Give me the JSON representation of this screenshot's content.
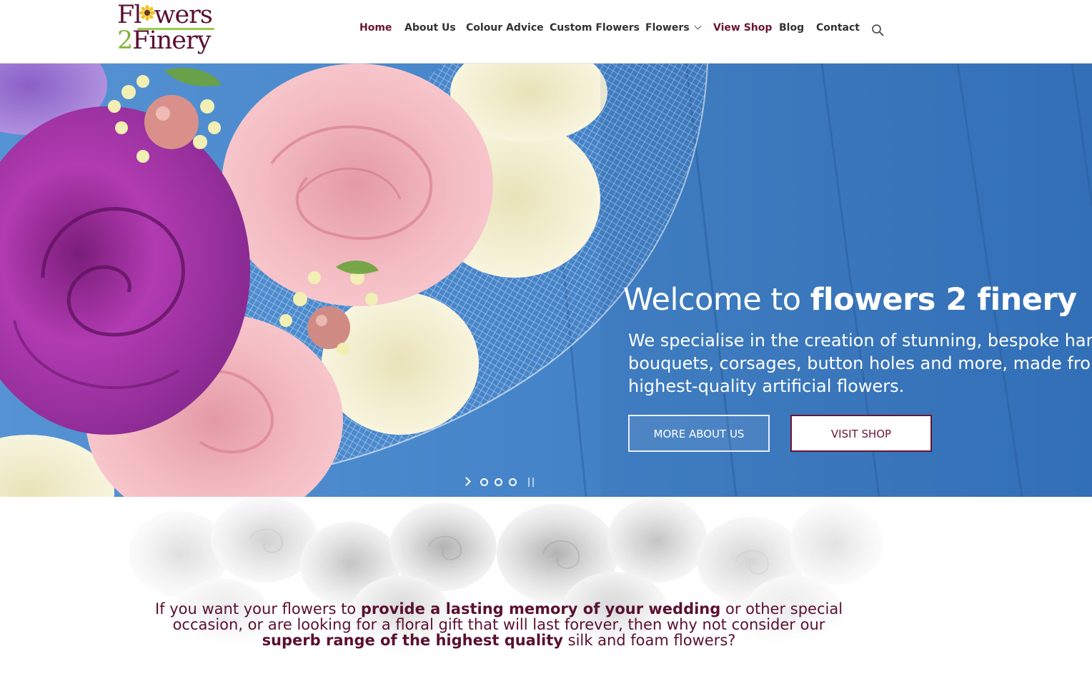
{
  "logo": {
    "line1_a": "Fl",
    "line1_b": "wers",
    "line2_a": "2",
    "line2_b": "Finery"
  },
  "nav": {
    "items": [
      {
        "label": "Home",
        "state": "active"
      },
      {
        "label": "About Us"
      },
      {
        "label": "Colour Advice"
      },
      {
        "label": "Custom Flowers"
      },
      {
        "label": "Flowers",
        "has_dropdown": true
      },
      {
        "label": "View Shop"
      },
      {
        "label": "Blog"
      },
      {
        "label": "Contact"
      }
    ],
    "search_icon": "search-icon"
  },
  "hero": {
    "title_prefix": "Welcome to ",
    "title_bold": "flowers 2 finery",
    "description_lines": [
      "We specialise in the creation of stunning, bespoke hand",
      "bouquets, corsages, button holes and more, made from",
      "highest-quality artificial flowers."
    ],
    "buttons": {
      "more_about": "MORE ABOUT US",
      "visit_shop": "VISIT SHOP"
    },
    "slider": {
      "dots": 3,
      "next_icon": "chevron-right-icon",
      "pause_icon": "pause-icon"
    }
  },
  "intro": {
    "p1": "If you want your flowers to ",
    "b1": "provide a lasting memory of your wedding",
    "p2": " or other special",
    "line2": "occasion, or are looking for a floral gift that will last forever, then why not consider our",
    "b2": "superb range of the highest quality",
    "p3": " silk and foam flowers?"
  },
  "colors": {
    "brand": "#6b1434",
    "accent_green": "#7fb539",
    "hero_blue": "#3d7fc6"
  }
}
